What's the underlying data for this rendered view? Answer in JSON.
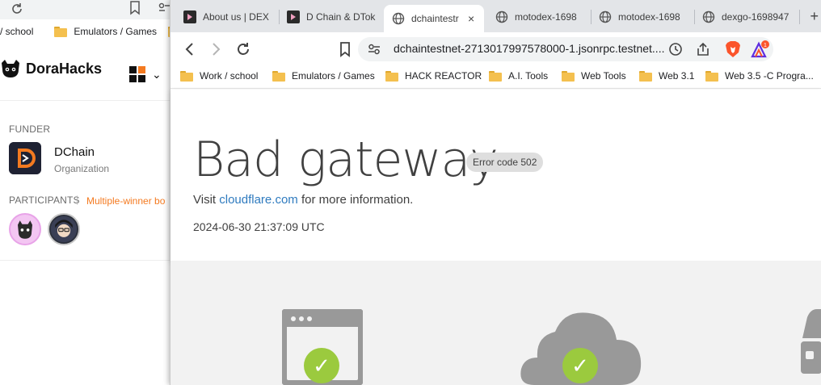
{
  "background_window": {
    "bookmarks": [
      {
        "label": "/ school"
      },
      {
        "label": "Emulators / Games"
      }
    ],
    "site": {
      "brand": "DoraHacks",
      "funder_label": "FUNDER",
      "funder_name": "DChain",
      "funder_type": "Organization",
      "participants_label": "PARTICIPANTS",
      "participants_sep": "|",
      "multi_winner": "Multiple-winner bo"
    }
  },
  "browser": {
    "tabs": [
      {
        "label": "About us | DEX"
      },
      {
        "label": "D Chain & DTok"
      },
      {
        "label": "dchaintestr",
        "active": true
      },
      {
        "label": "motodex-1698"
      },
      {
        "label": "motodex-1698"
      },
      {
        "label": "dexgo-1698947"
      }
    ],
    "new_tab_symbol": "+",
    "close_symbol": "×",
    "url": "dchaintestnet-2713017997578000-1.jsonrpc.testnet....",
    "rewards_badge": "1",
    "bookmarks": [
      {
        "label": "Work / school"
      },
      {
        "label": "Emulators / Games"
      },
      {
        "label": "HACK REACTOR"
      },
      {
        "label": "A.I. Tools"
      },
      {
        "label": "Web Tools"
      },
      {
        "label": "Web 3.1"
      },
      {
        "label": "Web 3.5  -C Progra..."
      }
    ]
  },
  "error_page": {
    "title": "Bad gateway",
    "code_badge": "Error code 502",
    "visit_prefix": "Visit ",
    "visit_link": "cloudflare.com",
    "visit_suffix": " for more information.",
    "timestamp": "2024-06-30 21:37:09 UTC",
    "status_icons": [
      {
        "name": "browser",
        "state": "ok"
      },
      {
        "name": "cloudflare",
        "state": "ok"
      },
      {
        "name": "host",
        "state": "error"
      }
    ],
    "check_symbol": "✓"
  },
  "colors": {
    "dorahacks_orange": "#f47a20",
    "link_blue": "#2f7bbf",
    "check_green": "#9bca3e",
    "icon_gray": "#999999"
  }
}
